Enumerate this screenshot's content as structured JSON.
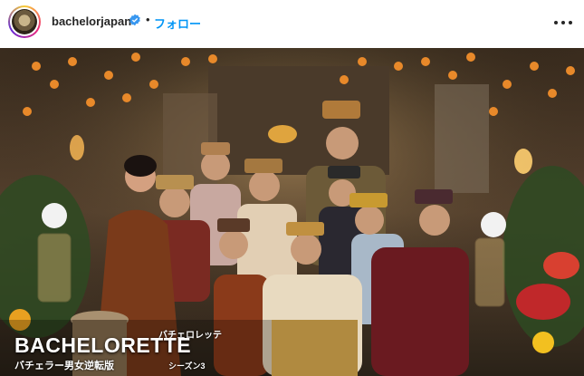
{
  "header": {
    "username": "bachelorjapan",
    "separator": "•",
    "follow_label": "フォロー",
    "verified_color": "#3897f0",
    "follow_color": "#0095f6"
  },
  "post_image": {
    "logo": {
      "title": "BACHELORETTE",
      "ruby": "バチェロレッテ",
      "subtitle": "バチェラー男女逆転版",
      "season": "シーズン3"
    }
  },
  "icons": {
    "verified": "verified-badge-icon",
    "more": "more-options-icon"
  }
}
